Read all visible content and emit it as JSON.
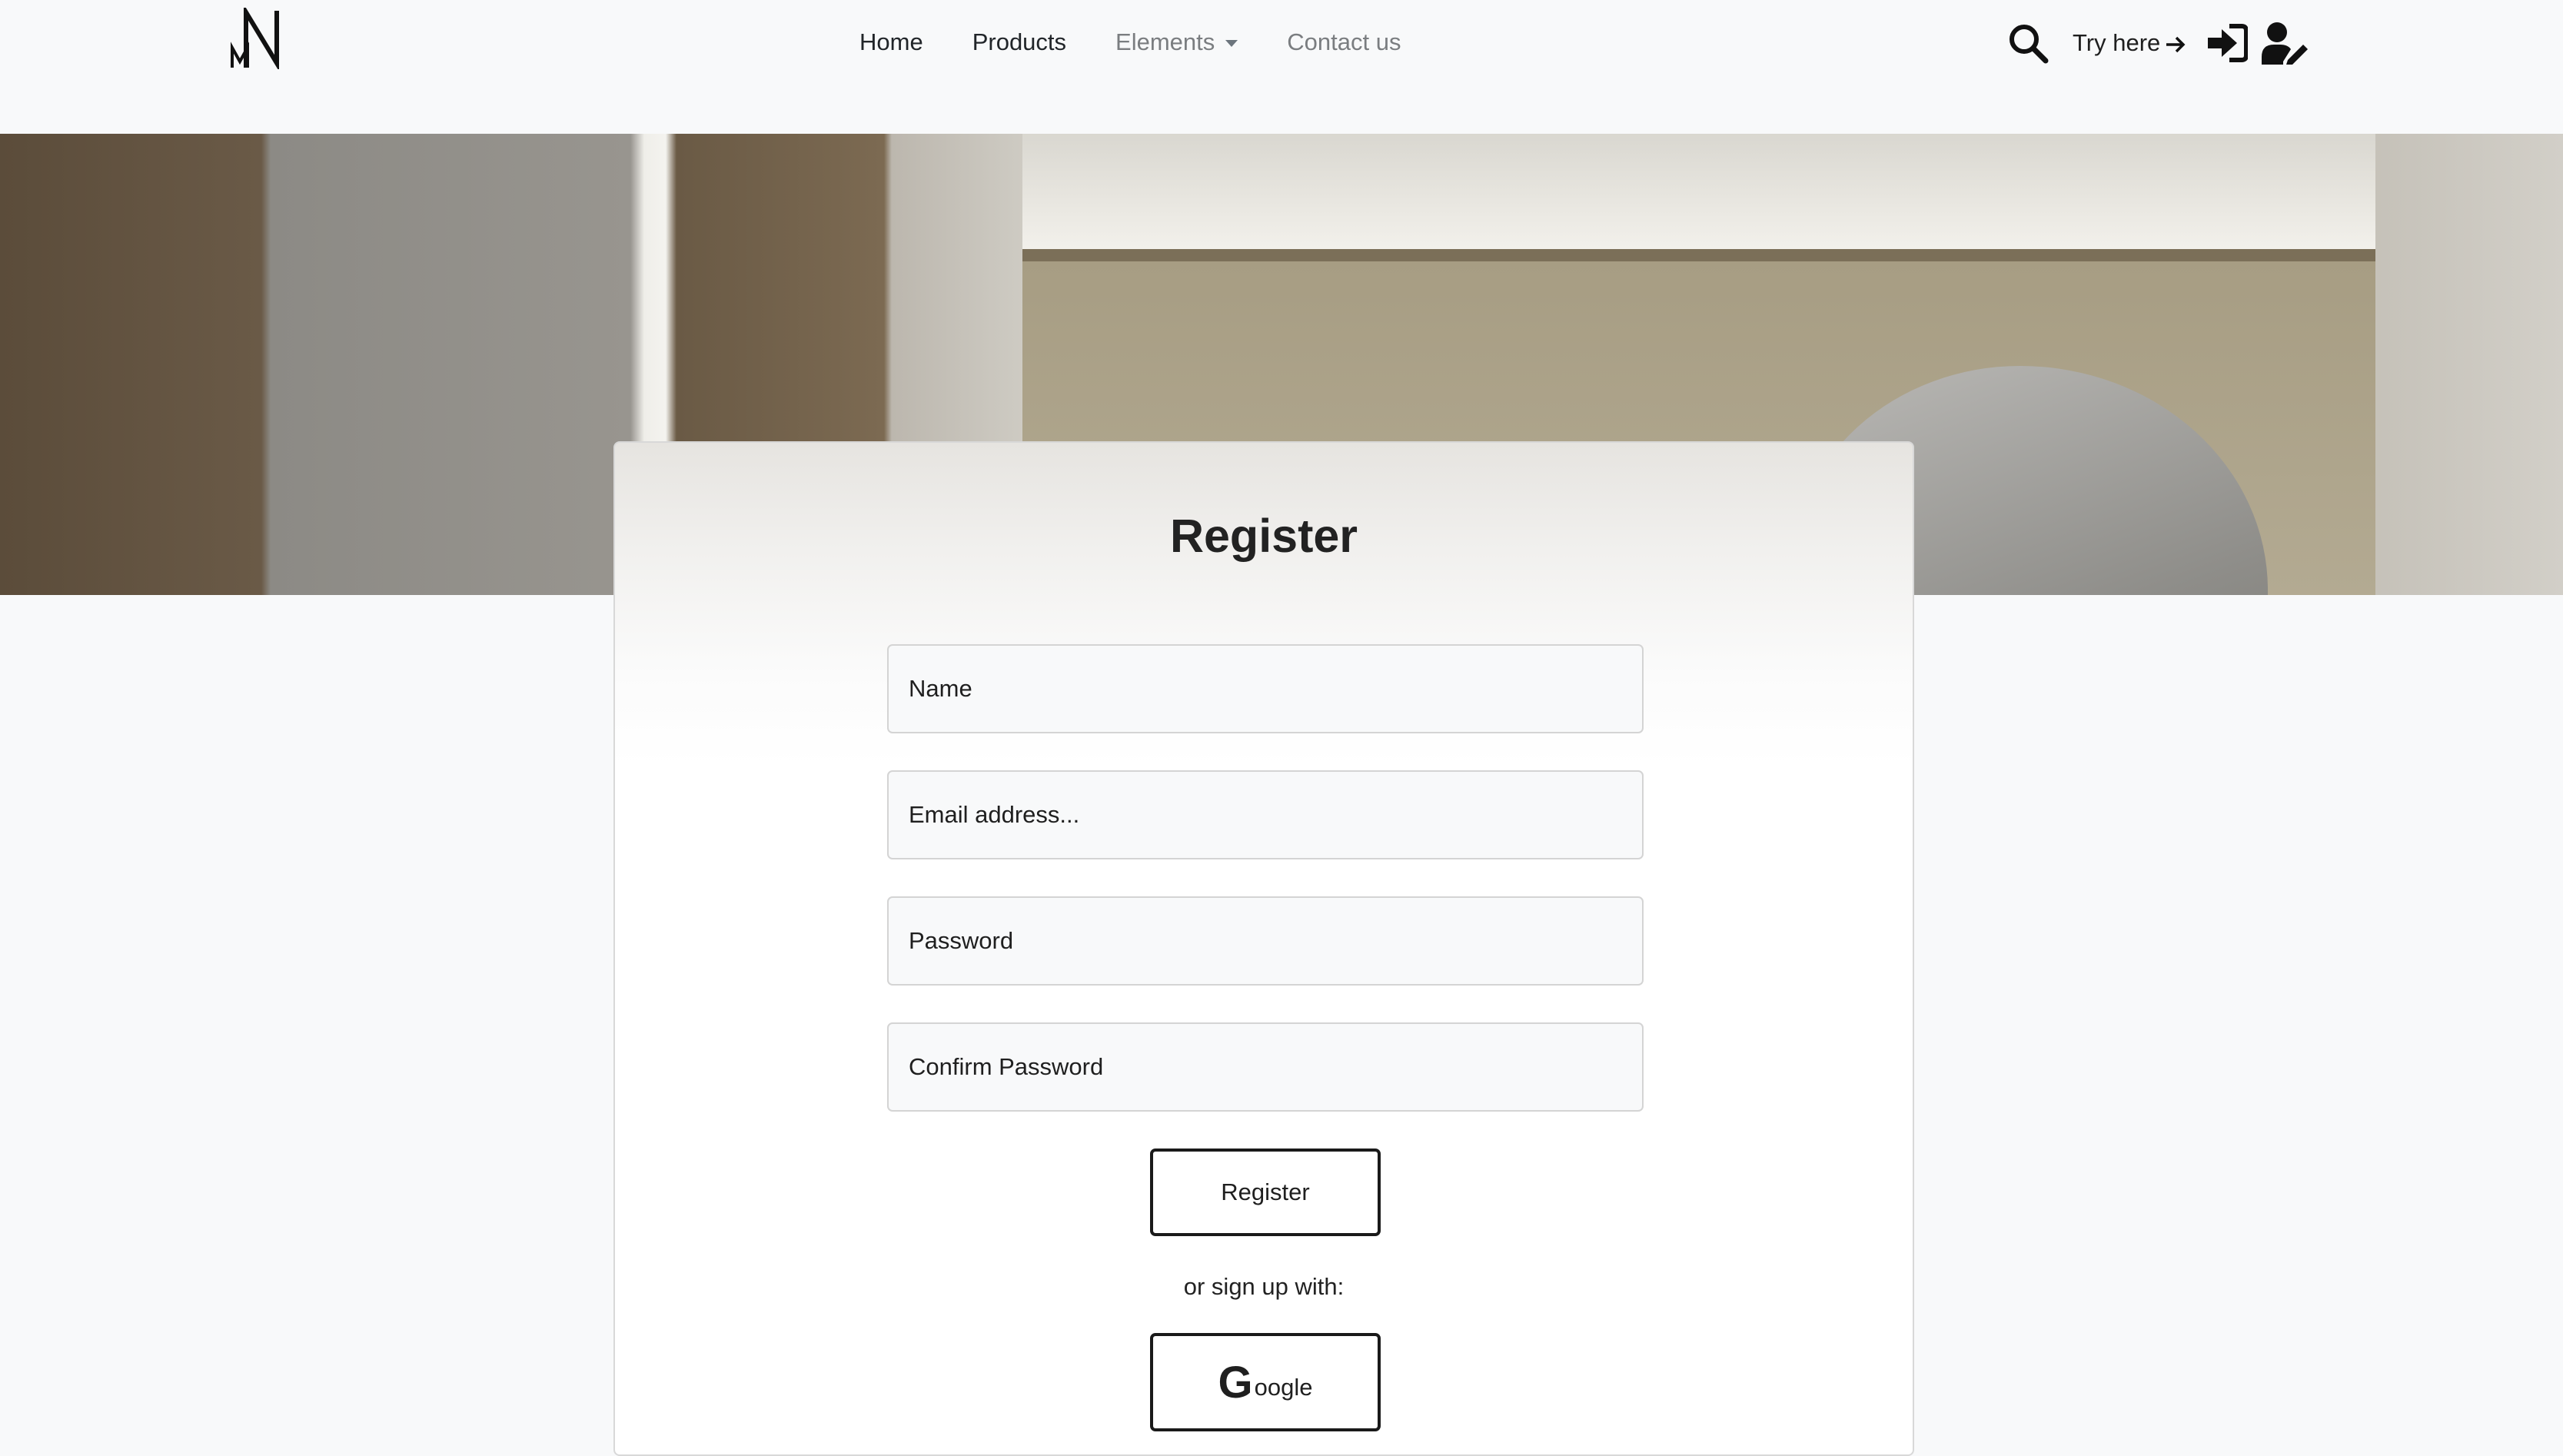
{
  "nav": {
    "links": [
      {
        "label": "Home"
      },
      {
        "label": "Products"
      },
      {
        "label": "Elements"
      },
      {
        "label": "Contact us"
      }
    ],
    "try_here": "Try here",
    "icons": [
      "brand-logo",
      "search-icon",
      "arrow-right-icon",
      "sign-in-icon",
      "user-edit-icon"
    ]
  },
  "register": {
    "title": "Register",
    "name_placeholder": "Name",
    "email_placeholder": "Email address...",
    "password_placeholder": "Password",
    "confirm_placeholder": "Confirm Password",
    "submit_label": "Register",
    "or_text": "or sign up with:",
    "google_g": "G",
    "google_rest": "oogle"
  },
  "colors": {
    "page_bg": "#f8f9fa",
    "text": "#1f1f1f",
    "muted_nav": "#7a7d80",
    "button_border": "#1a1a1a"
  }
}
